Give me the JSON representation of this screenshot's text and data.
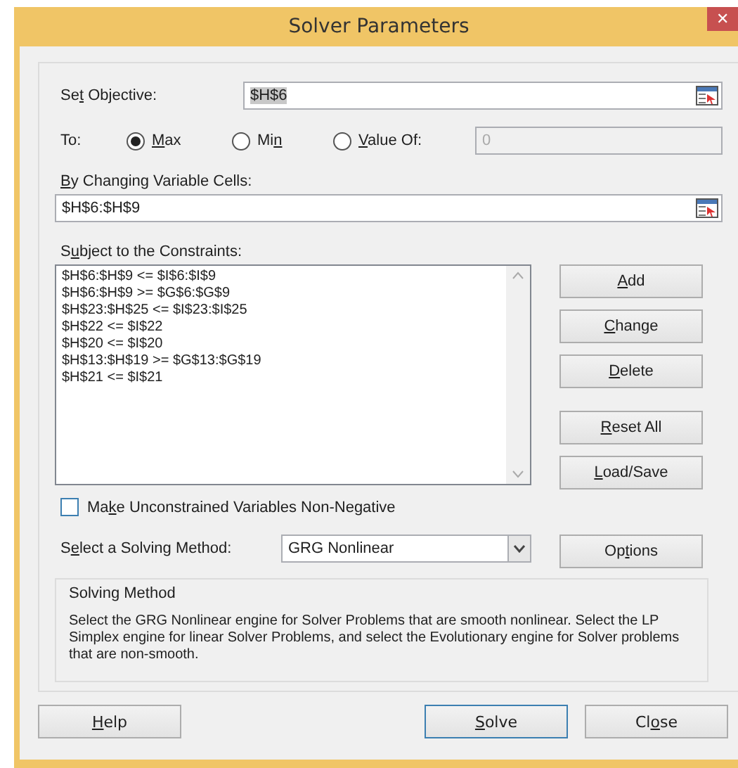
{
  "window": {
    "title": "Solver Parameters",
    "close_glyph": "✕"
  },
  "objective": {
    "label": {
      "before": "Se",
      "key": "t",
      "after": " Objective:"
    },
    "value": "$H$6"
  },
  "to": {
    "label": "To:",
    "options": [
      {
        "label": {
          "key": "M",
          "after": "ax"
        },
        "selected": true
      },
      {
        "label": {
          "before": "Mi",
          "key": "n"
        },
        "selected": false
      },
      {
        "label": {
          "key": "V",
          "after": "alue Of:"
        },
        "selected": false
      }
    ],
    "value_field": {
      "value": "0",
      "disabled": true
    }
  },
  "changing_cells": {
    "label": {
      "key": "B",
      "after": "y Changing Variable Cells:"
    },
    "value": "$H$6:$H$9"
  },
  "constraints": {
    "label": {
      "before": "S",
      "key": "u",
      "after": "bject to the Constraints:"
    },
    "items": [
      "$H$6:$H$9 <= $I$6:$I$9",
      "$H$6:$H$9 >= $G$6:$G$9",
      "$H$23:$H$25 <= $I$23:$I$25",
      "$H$22 <= $I$22",
      "$H$20 <= $I$20",
      "$H$13:$H$19 >= $G$13:$G$19",
      "$H$21 <= $I$21"
    ]
  },
  "side_buttons": [
    {
      "label": {
        "key": "A",
        "after": "dd"
      }
    },
    {
      "label": {
        "key": "C",
        "after": "hange"
      }
    },
    {
      "label": {
        "key": "D",
        "after": "elete"
      }
    },
    {
      "label": {
        "key": "R",
        "after": "eset All"
      }
    },
    {
      "label": {
        "key": "L",
        "after": "oad/Save"
      }
    }
  ],
  "non_negative": {
    "label": {
      "before": "Ma",
      "key": "k",
      "after": "e Unconstrained Variables Non-Negative"
    },
    "checked": false
  },
  "method": {
    "label": {
      "before": "S",
      "key": "e",
      "after": "lect a Solving Method:"
    },
    "value": "GRG Nonlinear",
    "options_button": {
      "before": "Op",
      "key": "t",
      "after": "ions"
    }
  },
  "method_info": {
    "title": "Solving Method",
    "text": "Select the GRG Nonlinear engine for Solver Problems that are smooth nonlinear. Select the LP Simplex engine for linear Solver Problems, and select the Evolutionary engine for Solver problems that are non-smooth."
  },
  "footer_buttons": [
    {
      "label": {
        "key": "H",
        "after": "elp"
      },
      "default": false
    },
    {
      "label": {
        "key": "S",
        "after": "olve"
      },
      "default": true
    },
    {
      "label": {
        "before": "Cl",
        "key": "o",
        "after": "se"
      },
      "default": false
    }
  ]
}
